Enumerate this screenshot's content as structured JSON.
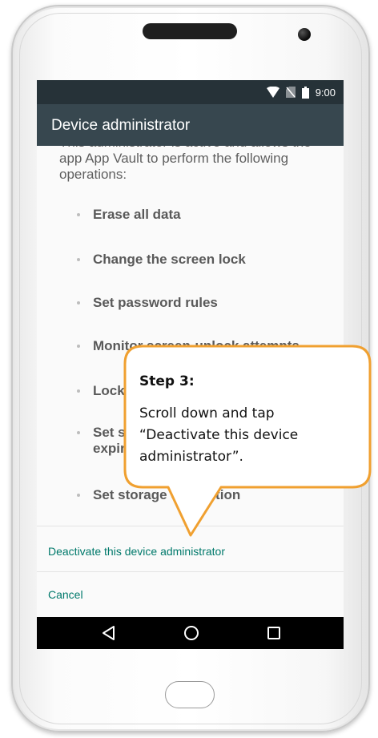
{
  "status_bar": {
    "time": "9:00",
    "icons": [
      "wifi-icon",
      "no-sim-icon",
      "battery-icon"
    ]
  },
  "app_bar": {
    "title": "Device administrator"
  },
  "content": {
    "intro": "This administrator is active and allows the app App Vault to perform the following operations:",
    "operations": [
      "Erase all data",
      "Change the screen lock",
      "Set password rules",
      "Monitor screen-unlock attempts",
      "Lock the screen",
      "Set screen lock password expiration",
      "Set storage encryption"
    ]
  },
  "actions": {
    "deactivate": "Deactivate this device administrator",
    "cancel": "Cancel"
  },
  "nav_bar": {
    "buttons": [
      "back-icon",
      "home-icon",
      "recents-icon"
    ]
  },
  "callout": {
    "title": "Step 3:",
    "text": "Scroll down and tap “Deactivate this device administrator”."
  },
  "colors": {
    "status_bar": "#263238",
    "app_bar": "#37474f",
    "accent": "#00796b",
    "callout_border": "#f0a030"
  }
}
